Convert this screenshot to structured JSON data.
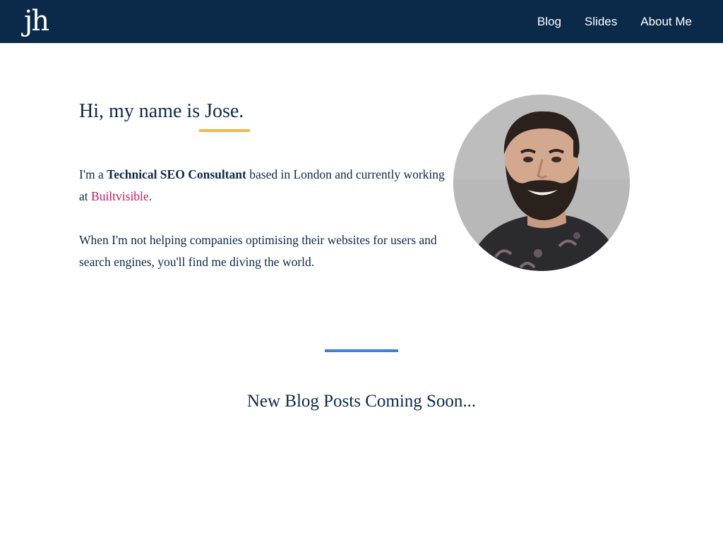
{
  "header": {
    "logo_text": "jh",
    "nav": [
      {
        "label": "Blog"
      },
      {
        "label": "Slides"
      },
      {
        "label": "About Me"
      }
    ]
  },
  "hero": {
    "title": "Hi, my name is Jose.",
    "intro": {
      "part1": "I'm a ",
      "role": "Technical SEO Consultant",
      "part2": " based in London and currently working at ",
      "employer": "Builtvisible",
      "part3": "."
    },
    "paragraph2": "When I'm not helping companies optimising their websites for users and search engines, you'll find me diving the world."
  },
  "blog": {
    "heading": "New Blog Posts Coming Soon..."
  },
  "colors": {
    "navbar_bg": "#0b2a4a",
    "title_underline": "#f5b84c",
    "link_accent": "#c8175d",
    "divider": "#3b82d6"
  }
}
